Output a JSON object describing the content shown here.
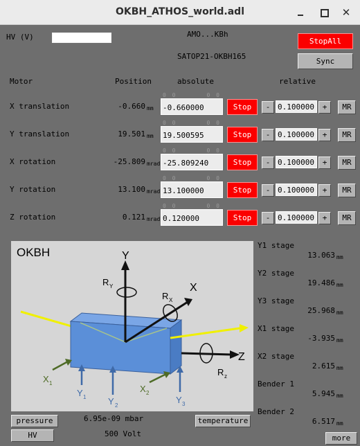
{
  "window": {
    "title": "OKBH_ATHOS_world.adl"
  },
  "header": {
    "hv_label": "HV  (V)",
    "device": "AMO...KBh",
    "system": "SATOP21-OKBH165",
    "stop_all": "StopAll",
    "sync": "Sync"
  },
  "columns": {
    "motor": "Motor",
    "position": "Position",
    "absolute": "absolute",
    "relative": "relative"
  },
  "motors": [
    {
      "name": "X translation",
      "position": "-0.660",
      "unit": "mm",
      "absolute": "-0.660000",
      "stop": "Stop",
      "minus": "-",
      "step": "0.100000",
      "plus": "+",
      "mr": "MR"
    },
    {
      "name": "Y translation",
      "position": "19.501",
      "unit": "mm",
      "absolute": "19.500595",
      "stop": "Stop",
      "minus": "-",
      "step": "0.100000",
      "plus": "+",
      "mr": "MR"
    },
    {
      "name": "X rotation",
      "position": "-25.809",
      "unit": "mrad",
      "absolute": "-25.809240",
      "stop": "Stop",
      "minus": "-",
      "step": "0.100000",
      "plus": "+",
      "mr": "MR"
    },
    {
      "name": "Y rotation",
      "position": "13.100",
      "unit": "mrad",
      "absolute": "13.100000",
      "stop": "Stop",
      "minus": "-",
      "step": "0.100000",
      "plus": "+",
      "mr": "MR"
    },
    {
      "name": "Z rotation",
      "position": "0.121",
      "unit": "mrad",
      "absolute": "0.120000",
      "stop": "Stop",
      "minus": "-",
      "step": "0.100000",
      "plus": "+",
      "mr": "MR"
    }
  ],
  "input_limits": [
    "0 0",
    "0 0"
  ],
  "stages": [
    {
      "name": "Y1 stage",
      "value": "13.063",
      "unit": "mm"
    },
    {
      "name": "Y2 stage",
      "value": "19.486",
      "unit": "mm"
    },
    {
      "name": "Y3 stage",
      "value": "25.968",
      "unit": "mm"
    },
    {
      "name": "X1 stage",
      "value": "-3.935",
      "unit": "mm"
    },
    {
      "name": "X2 stage",
      "value": "2.615",
      "unit": "mm"
    },
    {
      "name": "Bender 1",
      "value": "5.945",
      "unit": "mm"
    },
    {
      "name": "Bender 2",
      "value": "6.517",
      "unit": "mm"
    }
  ],
  "diagram": {
    "title": "OKBH",
    "labels": {
      "y": "Y",
      "x": "X",
      "z": "Z",
      "ry": "R",
      "ry_sub": "Y",
      "rx": "R",
      "rx_sub": "X",
      "rz": "R",
      "rz_sub": "z",
      "x1": "X",
      "x1_sub": "1",
      "x2": "X",
      "x2_sub": "2",
      "y1": "Y",
      "y1_sub": "1",
      "y2": "Y",
      "y2_sub": "2",
      "y3": "Y",
      "y3_sub": "3"
    }
  },
  "footer": {
    "pressure_button": "pressure",
    "pressure_value": "6.95e-09 mbar",
    "temperature_button": "temperature",
    "hv_button": "HV",
    "hv_value": "500 Volt",
    "more_button": "more"
  },
  "colors": {
    "stop_red": "#fb0000",
    "panel_gray": "#6e6e6e",
    "beam_yellow": "#f0f000",
    "mirror_blue": "#5b8fd8",
    "actuator_green": "#4e6b26",
    "actuator_blue": "#3f6aa8"
  }
}
